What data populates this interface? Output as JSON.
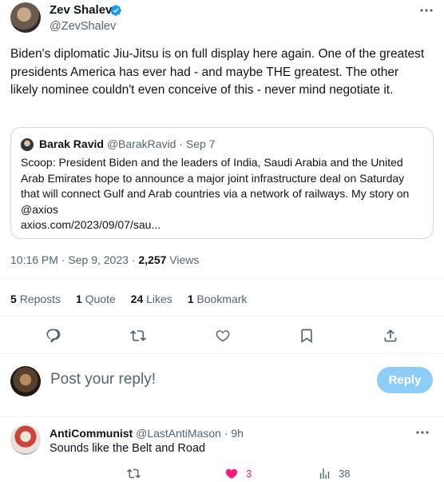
{
  "tweet": {
    "author_name": "Zev Shalev",
    "author_handle": "@ZevShalev",
    "text": "Biden's diplomatic Jiu-Jitsu is on full display here again.  One of the greatest presidents America has ever had - and maybe THE greatest. The other likely nominee couldn't even conceive of this - never mind negotiate it.",
    "quote": {
      "author_name": "Barak Ravid",
      "author_handle": "@BarakRavid",
      "date": "Sep 7",
      "text": "Scoop: President Biden and the leaders of India, Saudi Arabia and the United Arab Emirates hope to announce a major joint infrastructure deal on Saturday that will connect Gulf and Arab countries via a network of railways. My story on @axios",
      "link": "axios.com/2023/09/07/sau..."
    },
    "time": "10:16 PM",
    "date": "Sep 9, 2023",
    "views_count": "2,257",
    "views_label": "Views"
  },
  "stats": [
    {
      "count": "5",
      "label": "Reposts"
    },
    {
      "count": "1",
      "label": "Quote"
    },
    {
      "count": "24",
      "label": "Likes"
    },
    {
      "count": "1",
      "label": "Bookmark"
    }
  ],
  "action_icons": [
    "reply-icon",
    "repost-icon",
    "like-icon",
    "bookmark-icon",
    "share-icon"
  ],
  "reply_box": {
    "placeholder": "Post your reply!",
    "button_label": "Reply"
  },
  "reply": {
    "author_name": "AntiCommunist",
    "author_handle": "@LastAntiMason",
    "time": "9h",
    "text": "Sounds like the Belt and Road",
    "likes": "3",
    "views": "38"
  },
  "colors": {
    "verified": "#1d9bf0",
    "reply_button": "#8ecdf7",
    "like_pink": "#f91880",
    "muted_text": "#536471"
  }
}
